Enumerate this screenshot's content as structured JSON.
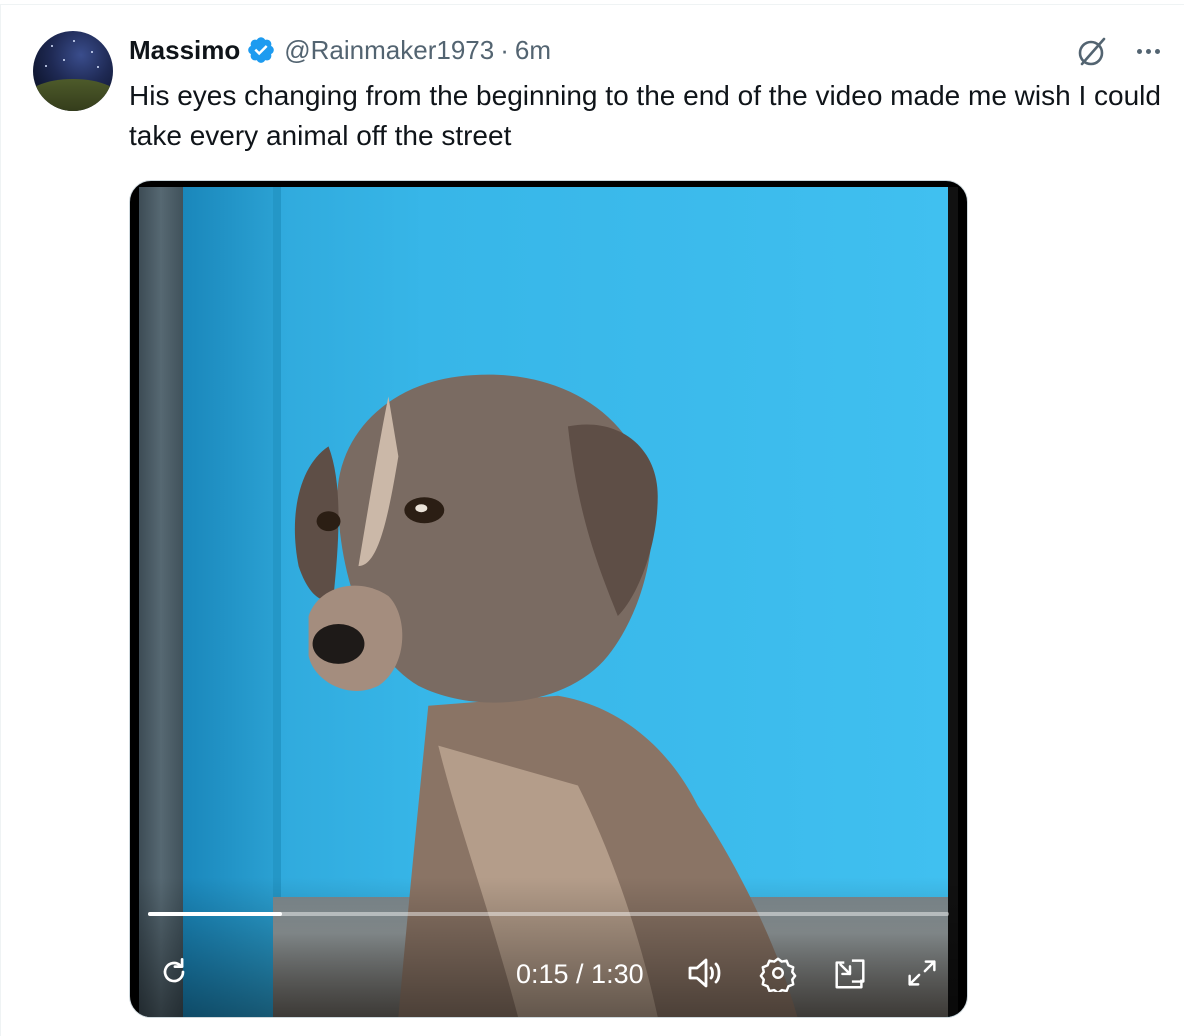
{
  "tweet": {
    "author": {
      "display_name": "Massimo",
      "handle": "@Rainmaker1973",
      "verified": true,
      "avatar_icon": "night-sky-avatar"
    },
    "separator": "·",
    "time": "6m",
    "text": "His eyes changing from the beginning to the end of the video made me wish I could take every animal off the street",
    "actions": {
      "grok_icon": "grok-icon",
      "more_icon": "more-icon"
    }
  },
  "video": {
    "current_time": "0:15",
    "duration": "1:30",
    "time_display": "0:15 / 1:30",
    "progress_fraction": 0.167,
    "controls": [
      "replay-icon",
      "volume-icon",
      "settings-icon",
      "picture-in-picture-icon",
      "fullscreen-icon"
    ]
  },
  "colors": {
    "text_primary": "#0f1419",
    "text_secondary": "#536471",
    "verified_blue": "#1d9bf0",
    "border": "#cfd9de"
  }
}
